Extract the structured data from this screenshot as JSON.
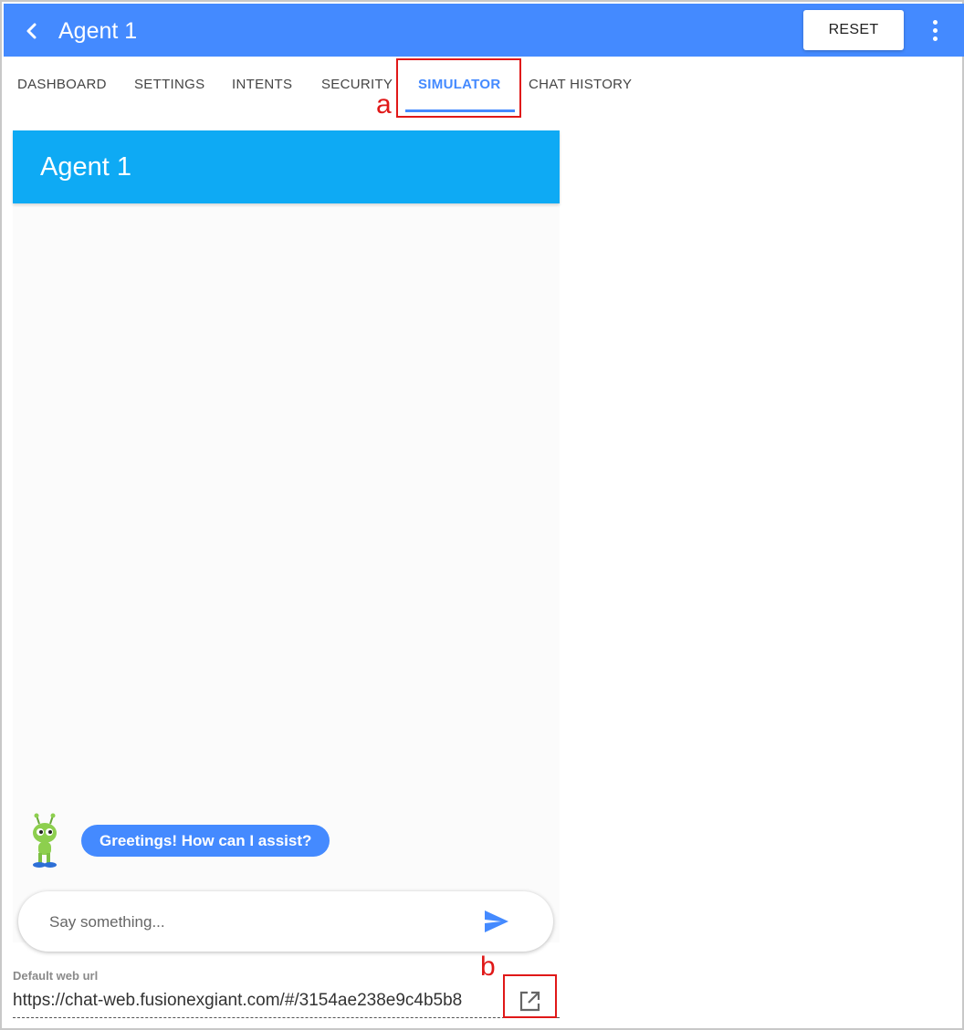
{
  "header": {
    "title": "Agent 1",
    "reset_label": "RESET",
    "back_icon": "chevron-left-icon",
    "more_icon": "more-vert-icon"
  },
  "tabs": [
    {
      "label": "DASHBOARD"
    },
    {
      "label": "SETTINGS"
    },
    {
      "label": "INTENTS"
    },
    {
      "label": "SECURITY"
    },
    {
      "label": "SIMULATOR",
      "active": true
    },
    {
      "label": "CHAT HISTORY"
    }
  ],
  "annotations": {
    "a": "a",
    "b": "b"
  },
  "simulator": {
    "title": "Agent 1",
    "bot_message": "Greetings! How can I assist?",
    "input_placeholder": "Say something...",
    "send_icon": "send-icon"
  },
  "web_url": {
    "label": "Default web url",
    "value": "https://chat-web.fusionexgiant.com/#/3154ae238e9c4b5b8",
    "open_icon": "open-in-new-icon"
  },
  "colors": {
    "primary": "#448aff",
    "simulator_header": "#0eaaf4",
    "annotation": "#e01818"
  }
}
